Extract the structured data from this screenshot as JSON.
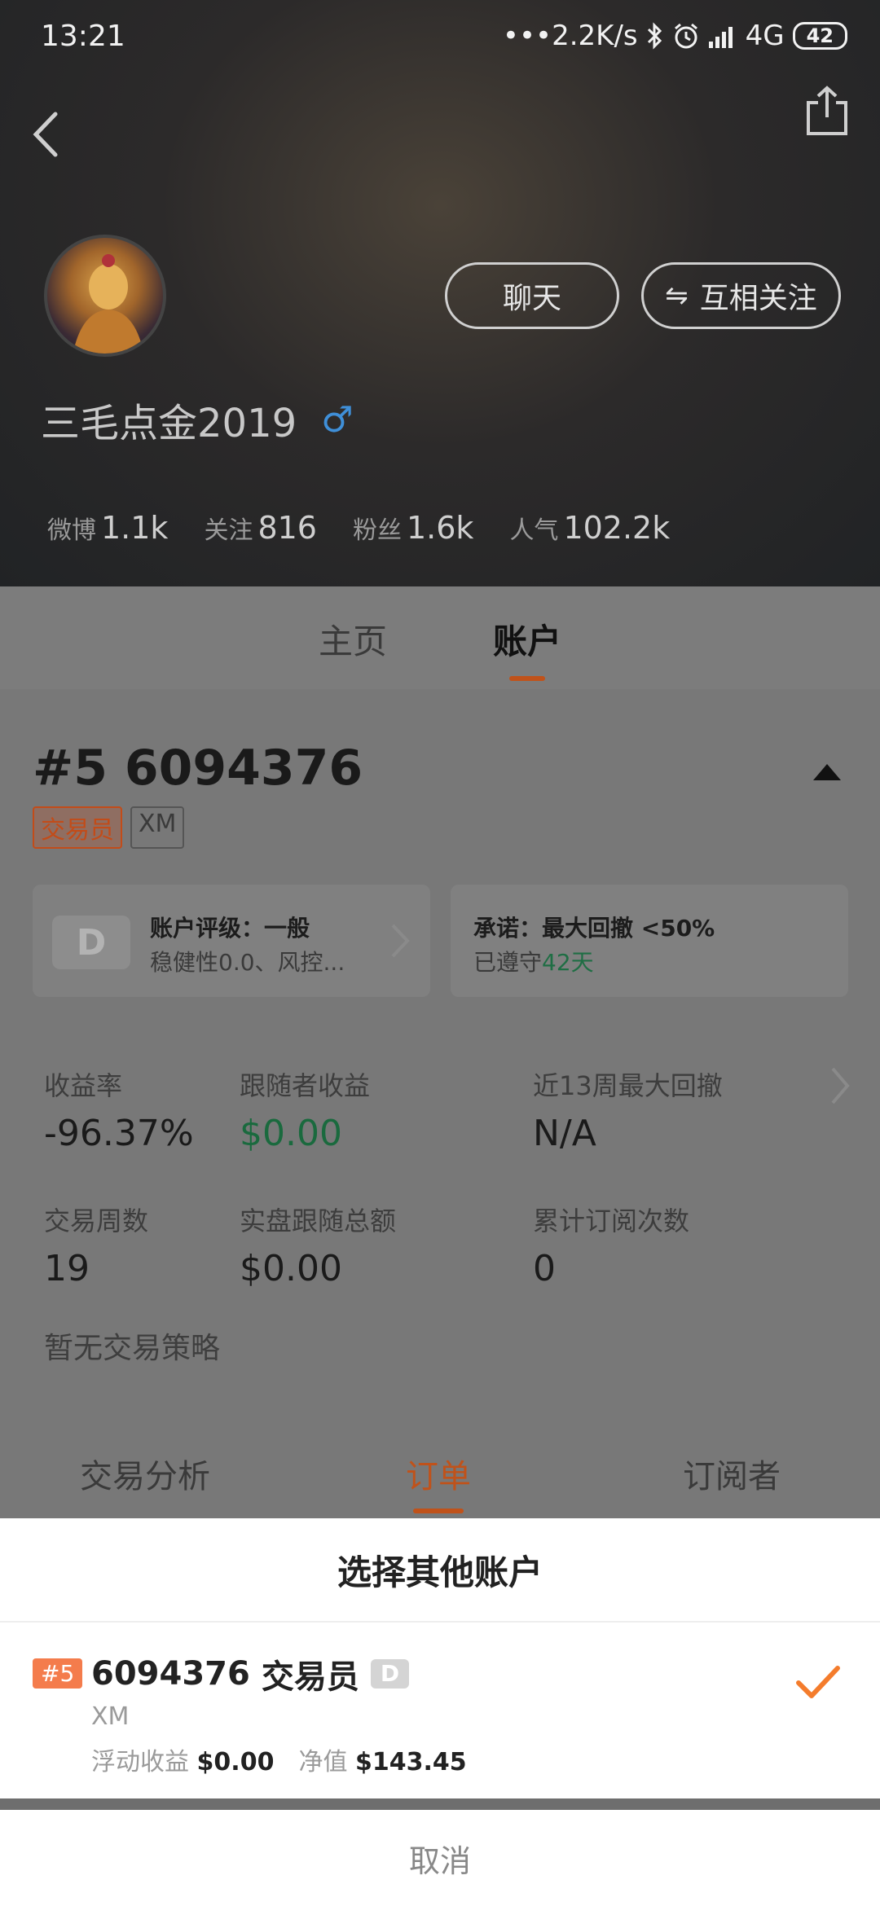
{
  "status_bar": {
    "time": "13:21",
    "network_speed": "•••2.2K/s",
    "network_type": "4G",
    "battery": "42"
  },
  "profile": {
    "username": "三毛点金2019",
    "gender_symbol": "♂",
    "chat_label": "聊天",
    "follow_label": "互相关注",
    "stats": [
      {
        "label": "微博",
        "value": "1.1k"
      },
      {
        "label": "关注",
        "value": "816"
      },
      {
        "label": "粉丝",
        "value": "1.6k"
      },
      {
        "label": "人气",
        "value": "102.2k"
      }
    ]
  },
  "tabs": [
    {
      "label": "主页",
      "active": false
    },
    {
      "label": "账户",
      "active": true
    }
  ],
  "account": {
    "title": "#5 6094376",
    "badges": [
      "交易员",
      "XM"
    ],
    "grade_letter": "D",
    "rating_label": "账户评级：一般",
    "rating_detail": "稳健性0.0、风控...",
    "promise_label": "承诺：最大回撤 <50%",
    "kept_prefix": "已遵守",
    "kept_days": "42天",
    "metrics": [
      {
        "label": "收益率",
        "value": "-96.37%"
      },
      {
        "label": "跟随者收益",
        "value": "$0.00"
      },
      {
        "label": "近13周最大回撤",
        "value": "N/A"
      },
      {
        "label": "交易周数",
        "value": "19"
      },
      {
        "label": "实盘跟随总额",
        "value": "$0.00"
      },
      {
        "label": "累计订阅次数",
        "value": "0"
      }
    ],
    "no_strategy": "暂无交易策略"
  },
  "sub_tabs": [
    {
      "label": "交易分析",
      "active": false
    },
    {
      "label": "订单",
      "active": true
    },
    {
      "label": "订阅者",
      "active": false
    }
  ],
  "sheet": {
    "title": "选择其他账户",
    "item": {
      "rank": "#5",
      "number": "6094376",
      "role": "交易员",
      "grade": "D",
      "broker": "XM",
      "floating_label": "浮动收益",
      "floating_value": "$0.00",
      "equity_label": "净值",
      "equity_value": "$143.45"
    },
    "cancel_label": "取消"
  },
  "colors": {
    "accent": "#f47c4c",
    "green": "#1f9b5a",
    "male_blue": "#3f8fd8"
  }
}
